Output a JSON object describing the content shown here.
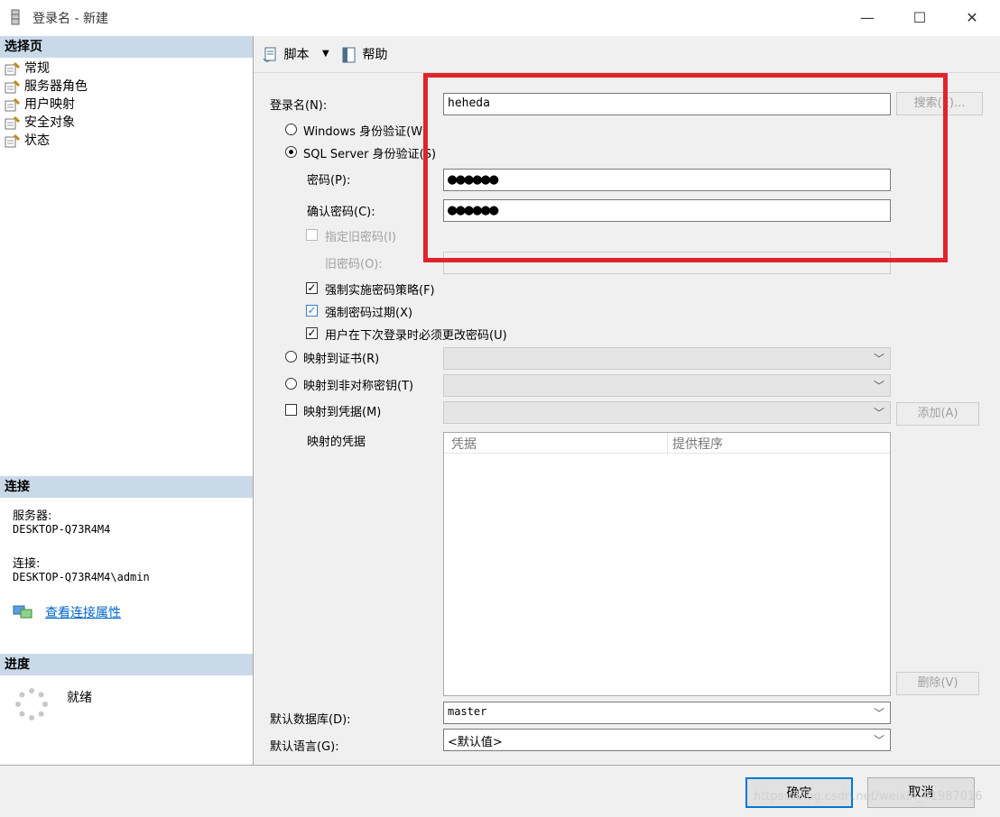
{
  "window": {
    "title": "登录名 - 新建",
    "minimize": "—",
    "maximize": "☐",
    "close": "✕"
  },
  "left": {
    "select_page_header": "选择页",
    "pages": [
      "常规",
      "服务器角色",
      "用户映射",
      "安全对象",
      "状态"
    ],
    "connection_header": "连接",
    "server_label": "服务器:",
    "server_value": "DESKTOP-Q73R4M4",
    "connection_label": "连接:",
    "connection_value": "DESKTOP-Q73R4M4\\admin",
    "view_props_link": "查看连接属性",
    "progress_header": "进度",
    "progress_status": "就绪"
  },
  "toolbar": {
    "script": "脚本",
    "help": "帮助"
  },
  "form": {
    "login_name_label": "登录名(N):",
    "login_name_value": "heheda",
    "search_button": "搜索(E)...",
    "windows_auth": "Windows 身份验证(W)",
    "sql_auth": "SQL Server 身份验证(S)",
    "password_label": "密码(P):",
    "password_value": "●●●●●●",
    "confirm_label": "确认密码(C):",
    "confirm_value": "●●●●●●",
    "specify_old": "指定旧密码(I)",
    "old_password_label": "旧密码(O):",
    "enforce_policy": "强制实施密码策略(F)",
    "enforce_expiration": "强制密码过期(X)",
    "must_change": "用户在下次登录时必须更改密码(U)",
    "map_cert": "映射到证书(R)",
    "map_asym": "映射到非对称密钥(T)",
    "map_cred": "映射到凭据(M)",
    "add_button": "添加(A)",
    "mapped_creds_label": "映射的凭据",
    "col_credential": "凭据",
    "col_provider": "提供程序",
    "remove_button": "删除(V)",
    "default_db_label": "默认数据库(D):",
    "default_db_value": "master",
    "default_lang_label": "默认语言(G):",
    "default_lang_value": "<默认值>"
  },
  "footer": {
    "ok": "确定",
    "cancel": "取消",
    "watermark": "https://blog.csdn.net/weixin_41987016"
  }
}
